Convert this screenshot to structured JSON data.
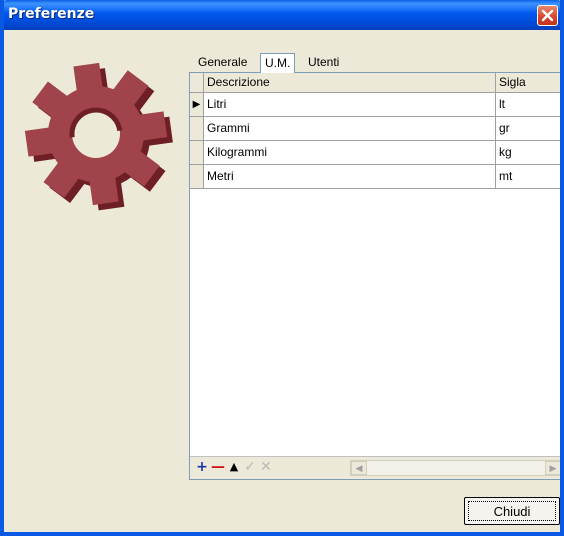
{
  "window": {
    "title": "Preferenze"
  },
  "tabs": [
    {
      "label": "Generale",
      "active": false
    },
    {
      "label": "U.M.",
      "active": true
    },
    {
      "label": "Utenti",
      "active": false
    }
  ],
  "grid": {
    "columns": [
      "Descrizione",
      "Sigla"
    ],
    "rows": [
      {
        "descrizione": "Litri",
        "sigla": "lt",
        "current": true
      },
      {
        "descrizione": "Grammi",
        "sigla": "gr",
        "current": false
      },
      {
        "descrizione": "Kilogrammi",
        "sigla": "kg",
        "current": false
      },
      {
        "descrizione": "Metri",
        "sigla": "mt",
        "current": false
      }
    ]
  },
  "navigator": {
    "add_icon": "plus-icon",
    "delete_icon": "minus-icon",
    "up_icon": "triangle-up-icon",
    "confirm_icon": "check-icon",
    "cancel_icon": "x-icon"
  },
  "footer": {
    "close_label": "Chiudi"
  },
  "colors": {
    "titlebar": "#0058ee",
    "window_bg": "#ece9d8",
    "gear": "#8b2e35",
    "close_button_red": "#d7432b"
  }
}
